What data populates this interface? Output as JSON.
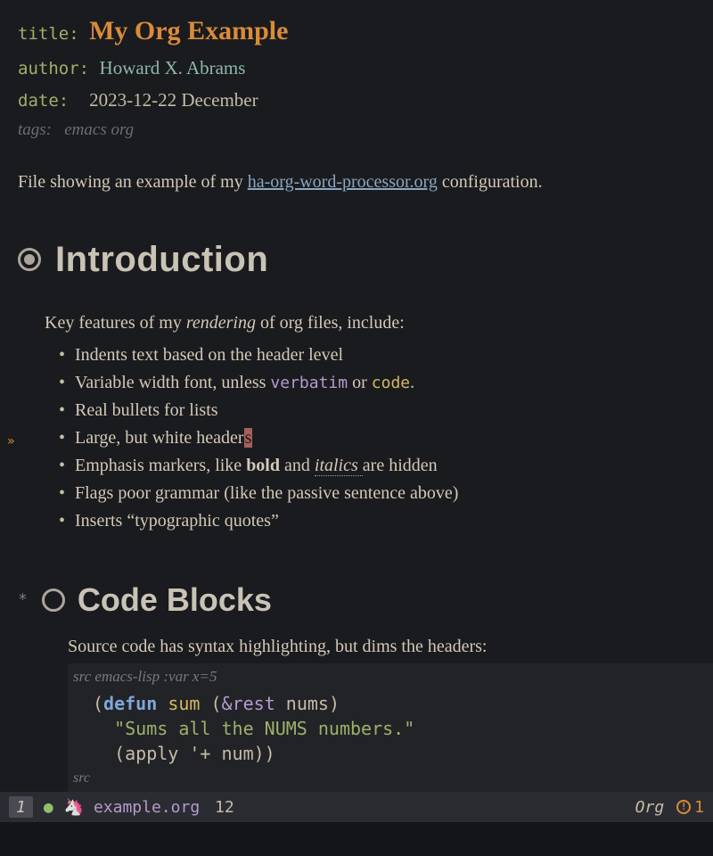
{
  "meta": {
    "title_key": "title",
    "title_val": "My Org Example",
    "author_key": "author",
    "author_val": "Howard X. Abrams",
    "date_key": "date",
    "date_val": "2023-12-22 December",
    "tags_key": "tags:",
    "tags_val": "emacs org"
  },
  "intro": {
    "before_link": "File showing an example of my ",
    "link_text": "ha-org-word-processor.org",
    "after_link": " configuration."
  },
  "h1": {
    "text": "Introduction",
    "lead_before_em": "Key features of my ",
    "lead_em": "rendering",
    "lead_after_em": " of org files, include:"
  },
  "list": {
    "i0": "Indents text based on the header level",
    "i1_a": "Variable width font, unless ",
    "i1_verb": "verbatim",
    "i1_b": " or ",
    "i1_code": "code",
    "i1_c": ".",
    "i2": "Real bullets for lists",
    "i3_a": "Large, but white header",
    "i3_cursor": "s",
    "i4_a": "Emphasis markers, like ",
    "i4_bold": "bold",
    "i4_b": " and ",
    "i4_ital": "italics ",
    "i4_c": "are hidden",
    "i5": "Flags poor grammar (like the passive sentence above)",
    "i6": "Inserts “typographic quotes”"
  },
  "h2": {
    "star": "*",
    "text": "Code Blocks",
    "lead": "Source code has syntax highlighting, but dims the headers:"
  },
  "src": {
    "header_a": "src ",
    "header_b": "emacs-lisp :var x=5",
    "line1_open": "(",
    "line1_defun": "defun",
    "line1_sp1": " ",
    "line1_fn": "sum",
    "line1_sp2": " (",
    "line1_amp": "&rest",
    "line1_sp3": " ",
    "line1_arg": "nums",
    "line1_close": ")",
    "line2_indent": "  ",
    "line2_str": "\"Sums all the NUMS numbers.\"",
    "line3_indent": "  ",
    "line3_a": "(apply '+ num))",
    "footer": "src"
  },
  "modeline": {
    "winnum": "1",
    "filename": "example.org",
    "line": "12",
    "mode": "Org",
    "warn_count": "1"
  }
}
